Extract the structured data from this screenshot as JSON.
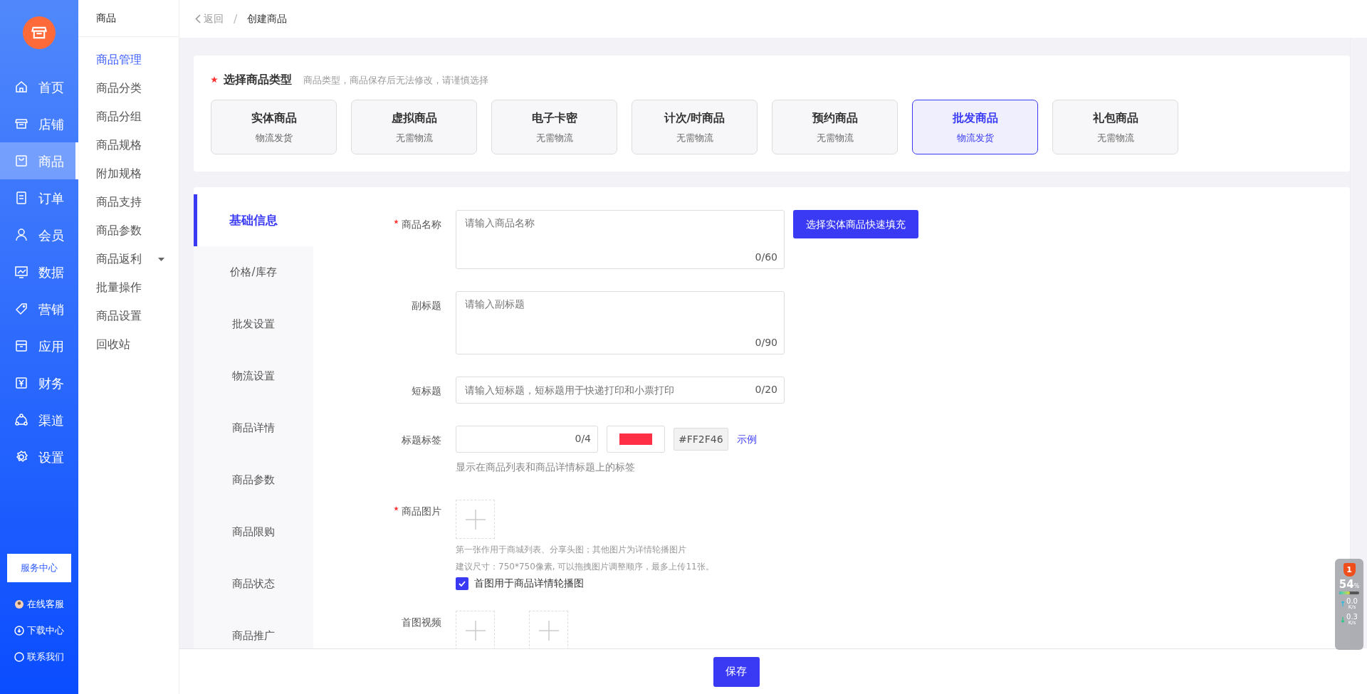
{
  "main_nav": {
    "items": [
      {
        "label": "首页",
        "selected": false
      },
      {
        "label": "店铺",
        "selected": false
      },
      {
        "label": "商品",
        "selected": true
      },
      {
        "label": "订单",
        "selected": false
      },
      {
        "label": "会员",
        "selected": false
      },
      {
        "label": "数据",
        "selected": false
      },
      {
        "label": "营销",
        "selected": false
      },
      {
        "label": "应用",
        "selected": false
      },
      {
        "label": "财务",
        "selected": false
      },
      {
        "label": "渠道",
        "selected": false
      },
      {
        "label": "设置",
        "selected": false
      }
    ],
    "service_button": "服务中心",
    "links": [
      {
        "label": "在线客服"
      },
      {
        "label": "下载中心"
      },
      {
        "label": "联系我们"
      }
    ]
  },
  "sub_nav": {
    "title": "商品",
    "items": [
      {
        "label": "商品管理",
        "selected": true,
        "expandable": false
      },
      {
        "label": "商品分类",
        "selected": false,
        "expandable": false
      },
      {
        "label": "商品分组",
        "selected": false,
        "expandable": false
      },
      {
        "label": "商品规格",
        "selected": false,
        "expandable": false
      },
      {
        "label": "附加规格",
        "selected": false,
        "expandable": false
      },
      {
        "label": "商品支持",
        "selected": false,
        "expandable": false
      },
      {
        "label": "商品参数",
        "selected": false,
        "expandable": false
      },
      {
        "label": "商品返利",
        "selected": false,
        "expandable": true
      },
      {
        "label": "批量操作",
        "selected": false,
        "expandable": false
      },
      {
        "label": "商品设置",
        "selected": false,
        "expandable": false
      },
      {
        "label": "回收站",
        "selected": false,
        "expandable": false
      }
    ]
  },
  "breadcrumb": {
    "back": "返回",
    "separator": "/",
    "current": "创建商品"
  },
  "type_section": {
    "title": "选择商品类型",
    "required": true,
    "hint": "商品类型，商品保存后无法修改，请谨慎选择",
    "types": [
      {
        "name": "实体商品",
        "note": "物流发货",
        "selected": false
      },
      {
        "name": "虚拟商品",
        "note": "无需物流",
        "selected": false
      },
      {
        "name": "电子卡密",
        "note": "无需物流",
        "selected": false
      },
      {
        "name": "计次/时商品",
        "note": "无需物流",
        "selected": false
      },
      {
        "name": "预约商品",
        "note": "无需物流",
        "selected": false
      },
      {
        "name": "批发商品",
        "note": "物流发货",
        "selected": true
      },
      {
        "name": "礼包商品",
        "note": "无需物流",
        "selected": false
      }
    ]
  },
  "form_tabs": [
    {
      "label": "基础信息",
      "selected": true
    },
    {
      "label": "价格/库存",
      "selected": false
    },
    {
      "label": "批发设置",
      "selected": false
    },
    {
      "label": "物流设置",
      "selected": false
    },
    {
      "label": "商品详情",
      "selected": false
    },
    {
      "label": "商品参数",
      "selected": false
    },
    {
      "label": "商品限购",
      "selected": false
    },
    {
      "label": "商品状态",
      "selected": false
    },
    {
      "label": "商品推广",
      "selected": false
    }
  ],
  "form": [
    {
      "kind": "textarea",
      "label": "商品名称",
      "required": true,
      "placeholder": "请输入商品名称",
      "counter": "0/60",
      "button": "选择实体商品快速填充"
    },
    {
      "kind": "textarea",
      "label": "副标题",
      "required": false,
      "placeholder": "请输入副标题",
      "counter": "0/90"
    },
    {
      "kind": "input",
      "label": "短标题",
      "required": false,
      "placeholder": "请输入短标题，短标题用于快递打印和小票打印",
      "counter": "0/20"
    },
    {
      "kind": "tag",
      "label": "标题标签",
      "required": false,
      "counter": "0/4",
      "color": "#ff2f46",
      "hex": "#FF2F46",
      "link": "示例",
      "hint": "显示在商品列表和商品详情标题上的标签"
    },
    {
      "kind": "image",
      "label": "商品图片",
      "required": true,
      "hints": [
        "第一张作用于商城列表、分享头图；其他图片为详情轮播图片",
        "建议尺寸：750*750像素, 可以拖拽图片调整顺序，最多上传11张。"
      ],
      "checkbox": {
        "label": "首图用于商品详情轮播图",
        "checked": true
      }
    },
    {
      "kind": "video",
      "label": "首图视频",
      "required": false
    }
  ],
  "save_button": "保存",
  "monitor": {
    "badge": "1",
    "cpu": "54",
    "cpu_unit": "%",
    "level": 0.54,
    "upload": {
      "value": "0.0",
      "unit": "K/s"
    },
    "download": {
      "value": "0.3",
      "unit": "K/s"
    }
  }
}
